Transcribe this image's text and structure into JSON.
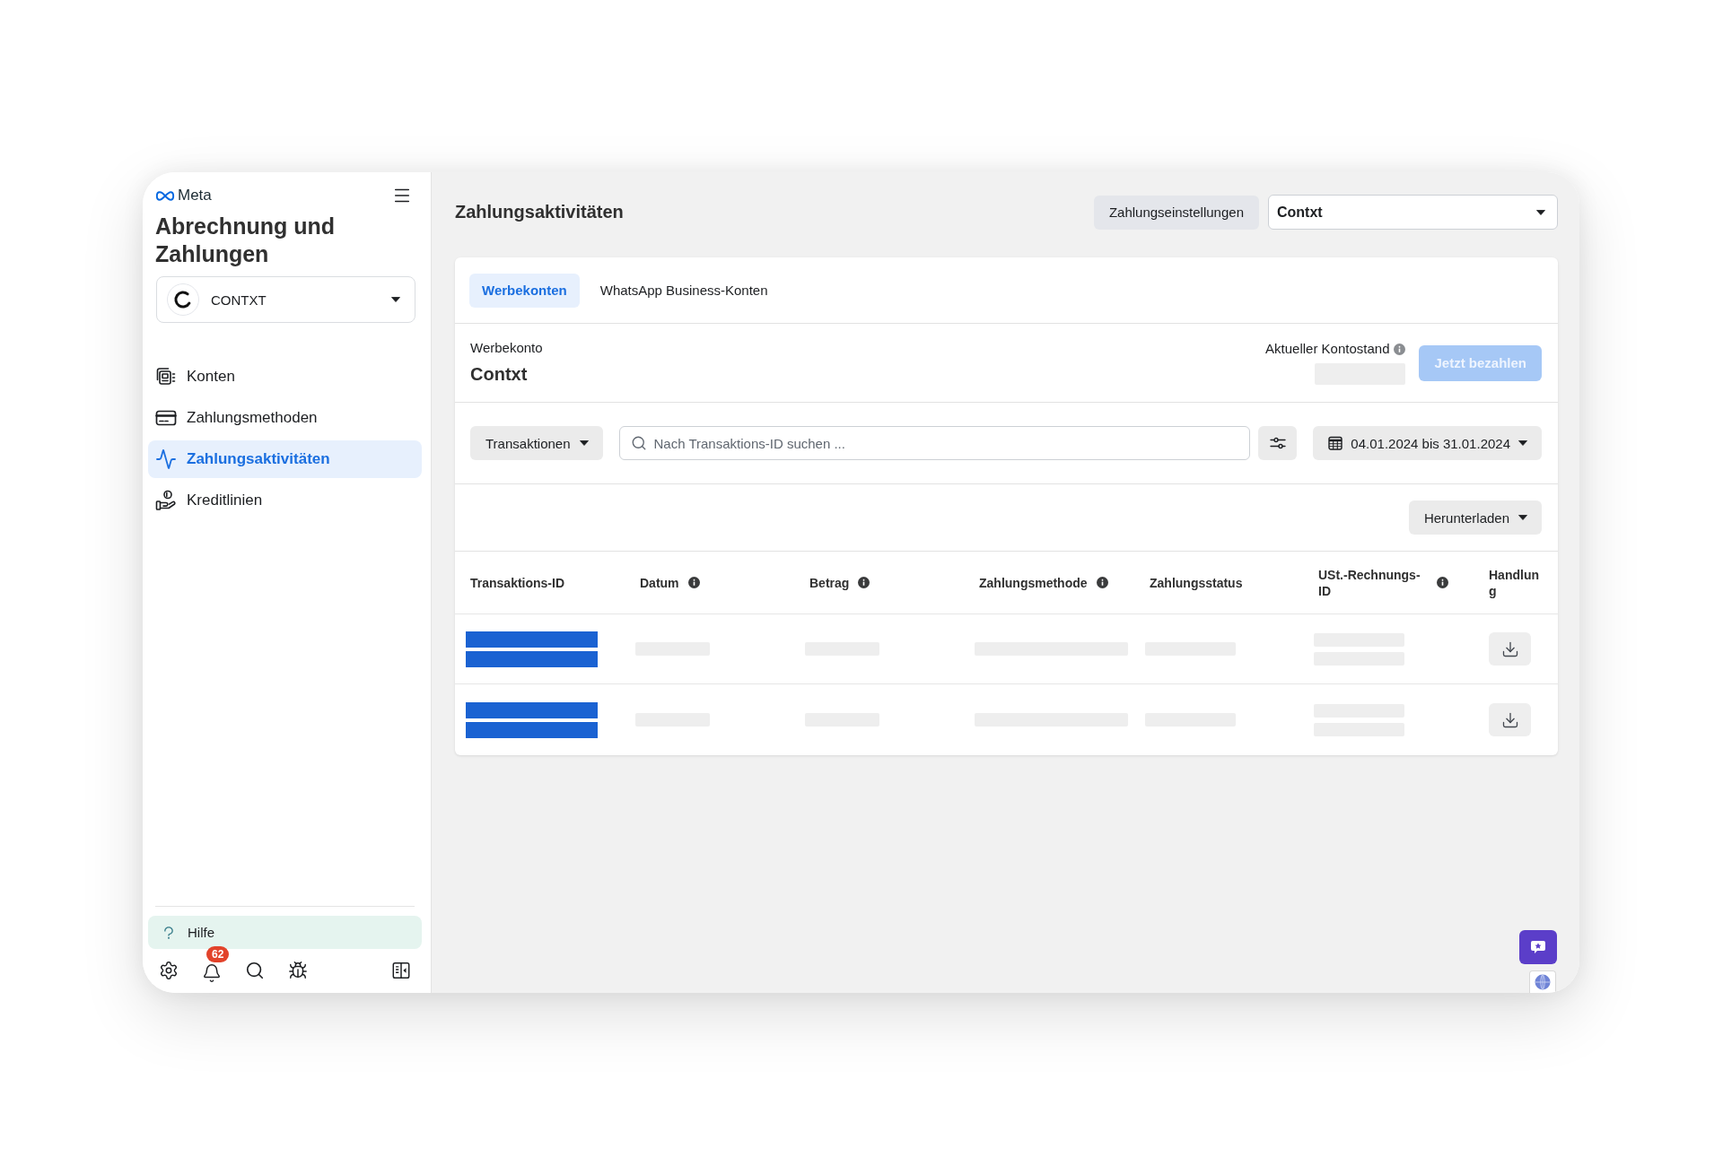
{
  "sidebar": {
    "logo_text": "Meta",
    "title": "Abrechnung und Zahlungen",
    "account_selector": {
      "value": "CONTXT"
    },
    "nav_items": [
      {
        "label": "Konten",
        "selected": false
      },
      {
        "label": "Zahlungsmethoden",
        "selected": false
      },
      {
        "label": "Zahlungsaktivitäten",
        "selected": true
      },
      {
        "label": "Kreditlinien",
        "selected": false
      }
    ],
    "help": {
      "label": "Hilfe"
    },
    "toolbar": {
      "notification_count": "62"
    }
  },
  "header": {
    "title": "Zahlungsaktivitäten",
    "settings_button": {
      "label": "Zahlungseinstellungen"
    },
    "account_dropdown": {
      "value": "Contxt"
    }
  },
  "card": {
    "tabs": [
      {
        "label": "Werbekonten",
        "selected": true
      },
      {
        "label": "WhatsApp Business-Konten",
        "selected": false
      }
    ],
    "account": {
      "label": "Werbekonto",
      "name": "Contxt"
    },
    "balance": {
      "label": "Aktueller Kontostand",
      "info": true,
      "loading": true
    },
    "pay_button": {
      "label": "Jetzt bezahlen",
      "disabled": true
    },
    "filters": {
      "type_dropdown": {
        "value": "Transaktionen"
      },
      "search": {
        "placeholder": "Nach Transaktions-ID suchen ..."
      },
      "date_range": {
        "value": "04.01.2024 bis 31.01.2024"
      }
    },
    "download_button": {
      "label": "Herunterladen"
    },
    "table": {
      "columns": [
        {
          "label": "Transaktions-ID",
          "info": false
        },
        {
          "label": "Datum",
          "info": true
        },
        {
          "label": "Betrag",
          "info": true
        },
        {
          "label": "Zahlungsmethode",
          "info": true
        },
        {
          "label": "Zahlungsstatus",
          "info": false
        },
        {
          "label": "USt.-Rechnungs-ID",
          "info": true
        },
        {
          "label": "Handlung",
          "info": false
        }
      ],
      "rows": [
        {
          "id_redacted": true,
          "loading": true
        },
        {
          "id_redacted": true,
          "loading": true
        }
      ]
    }
  }
}
